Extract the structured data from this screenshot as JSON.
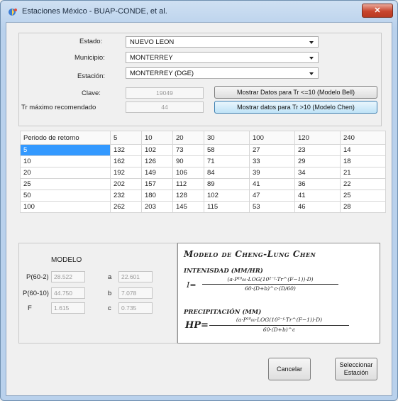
{
  "window": {
    "title": "Estaciones México  -  BUAP-CONDE, et al.",
    "close_label": "✕"
  },
  "station": {
    "estado_label": "Estado:",
    "estado_value": "NUEVO LEON",
    "municipio_label": "Municipio:",
    "municipio_value": "MONTERREY",
    "estacion_label": "Estación:",
    "estacion_value": "MONTERREY (DGE)",
    "clave_label": "Clave:",
    "clave_value": "19049",
    "tr_label": "Tr máximo recomendado",
    "tr_value": "44",
    "bell_button": "Mostrar Datos para Tr <=10 (Modelo Bell)",
    "chen_button": "Mostrar datos para Tr >10 (Modelo Chen)"
  },
  "table": {
    "headers": [
      "Periodo de retorno",
      "5",
      "10",
      "20",
      "30",
      "100",
      "120",
      "240"
    ],
    "rows": [
      [
        "5",
        "132",
        "102",
        "73",
        "58",
        "27",
        "23",
        "14"
      ],
      [
        "10",
        "162",
        "126",
        "90",
        "71",
        "33",
        "29",
        "18"
      ],
      [
        "20",
        "192",
        "149",
        "106",
        "84",
        "39",
        "34",
        "21"
      ],
      [
        "25",
        "202",
        "157",
        "112",
        "89",
        "41",
        "36",
        "22"
      ],
      [
        "50",
        "232",
        "180",
        "128",
        "102",
        "47",
        "41",
        "25"
      ],
      [
        "100",
        "262",
        "203",
        "145",
        "115",
        "53",
        "46",
        "28"
      ]
    ]
  },
  "modelo": {
    "title": "MODELO",
    "p602_label": "P(60-2)",
    "p602_value": "28.522",
    "p6010_label": "P(60-10)",
    "p6010_value": "44.750",
    "f_label": "F",
    "f_value": "1.615",
    "a_label": "a",
    "a_value": "22.601",
    "b_label": "b",
    "b_value": "7.078",
    "c_label": "c",
    "c_value": "0.735"
  },
  "formula": {
    "title": "Modelo de Cheng-Lung Chen",
    "intensidad_title": "INTENISDAD (MM/HR)",
    "intensidad_lhs": "I=",
    "intensidad_num": "(a·P¹⁰₆₀·LOG(10²⁻ᶠ·Tr^(F−1))·D)",
    "intensidad_den": "60·(D+b)^c·(D/60)",
    "precip_title": "PRECIPITACIÓN (MM)",
    "precip_lhs": "HP=",
    "precip_num": "(a·P¹⁰₆₀·LOG(10²⁻ᶠ·Tr^(F−1))·D)",
    "precip_den": "60·(D+b)^c"
  },
  "buttons": {
    "cancel": "Cancelar",
    "select_line1": "Seleccionar",
    "select_line2": "Estación"
  }
}
